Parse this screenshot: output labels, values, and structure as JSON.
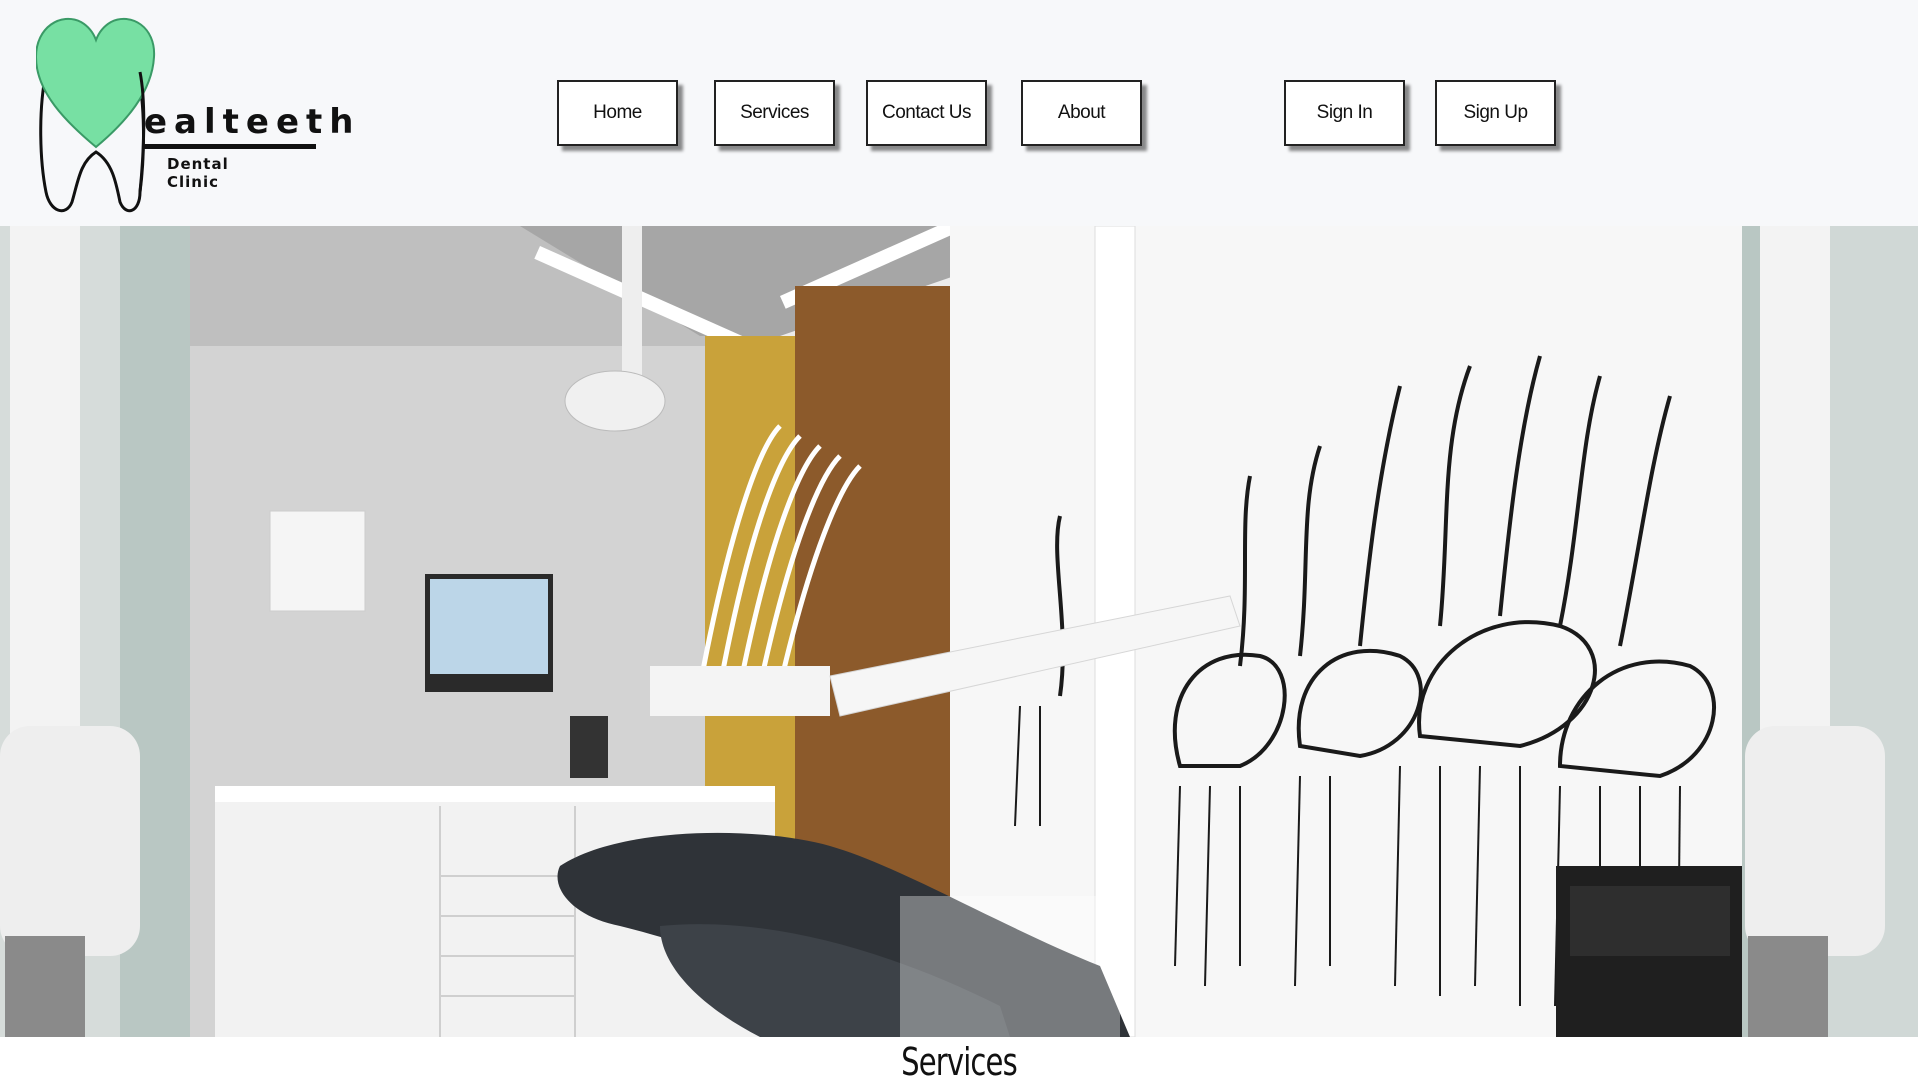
{
  "logo": {
    "name": "ealteeth",
    "subtitle": "Dental Clinic",
    "heart_color": "#77e0a3"
  },
  "nav": {
    "home": "Home",
    "services": "Services",
    "contact": "Contact Us",
    "about": "About",
    "sign_in": "Sign In",
    "sign_up": "Sign Up"
  },
  "hero": {
    "image": "dental clinic interior with dental chair and flamingo wall mural"
  },
  "section": {
    "title": "Services"
  }
}
